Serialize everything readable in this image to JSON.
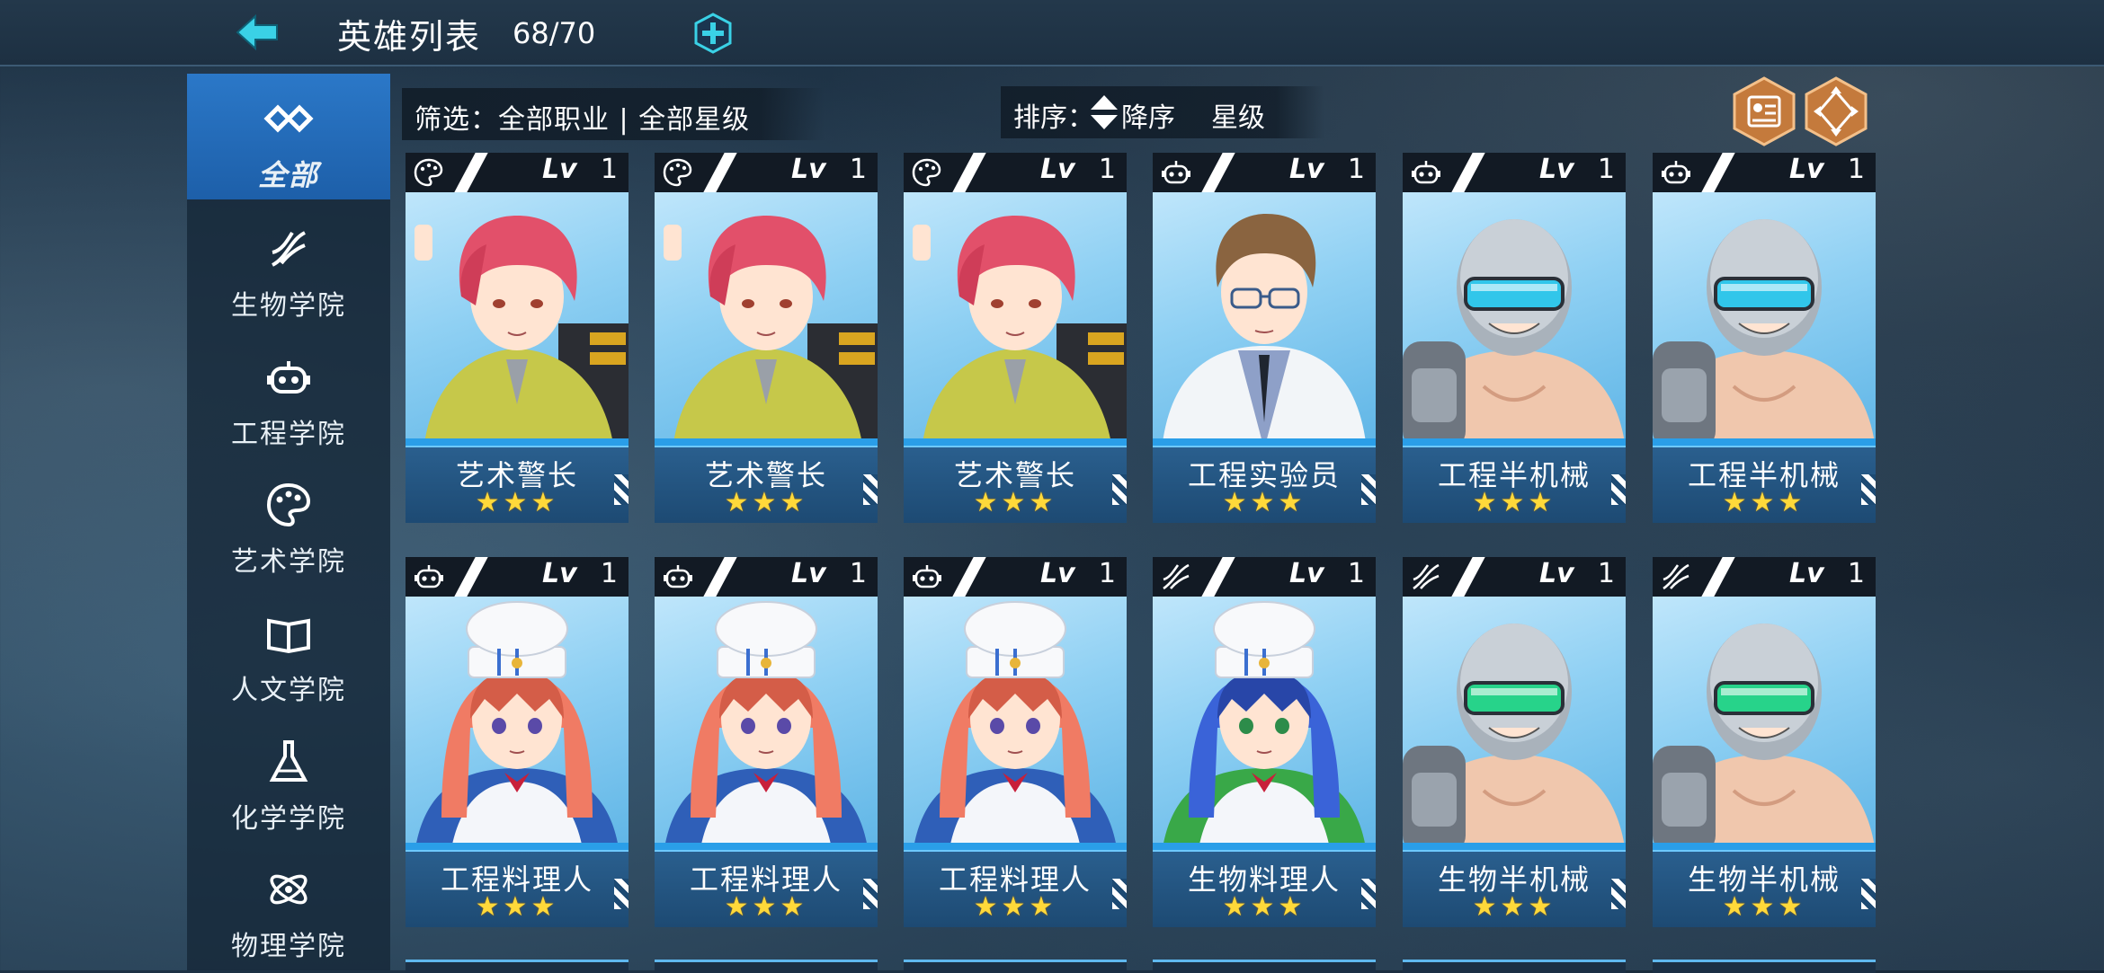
{
  "header": {
    "title": "英雄列表",
    "count": "68/70"
  },
  "sidebar": {
    "items": [
      {
        "label": "全部",
        "icon": "infinity-icon",
        "active": true
      },
      {
        "label": "生物学院",
        "icon": "dna-icon",
        "active": false
      },
      {
        "label": "工程学院",
        "icon": "robot-icon",
        "active": false
      },
      {
        "label": "艺术学院",
        "icon": "palette-icon",
        "active": false
      },
      {
        "label": "人文学院",
        "icon": "book-icon",
        "active": false
      },
      {
        "label": "化学学院",
        "icon": "flask-icon",
        "active": false
      },
      {
        "label": "物理学院",
        "icon": "atom-icon",
        "active": false
      }
    ]
  },
  "filter": {
    "label": "筛选：全部职业 | 全部星级"
  },
  "sort": {
    "label": "排序：",
    "order": "降序",
    "field": "星级"
  },
  "colors": {
    "accent": "#2b78c8",
    "star": "#ffd93a",
    "card_bottom": "#1d4a73"
  },
  "heroes": [
    {
      "name": "艺术警长",
      "class_icon": "palette-icon",
      "lv_label": "Lv",
      "level": "1",
      "stars": "★★★",
      "portrait": "red-hair-boy"
    },
    {
      "name": "艺术警长",
      "class_icon": "palette-icon",
      "lv_label": "Lv",
      "level": "1",
      "stars": "★★★",
      "portrait": "red-hair-boy"
    },
    {
      "name": "艺术警长",
      "class_icon": "palette-icon",
      "lv_label": "Lv",
      "level": "1",
      "stars": "★★★",
      "portrait": "red-hair-boy"
    },
    {
      "name": "工程实验员",
      "class_icon": "robot-icon",
      "lv_label": "Lv",
      "level": "1",
      "stars": "★★★",
      "portrait": "glasses-scientist"
    },
    {
      "name": "工程半机械",
      "class_icon": "robot-icon",
      "lv_label": "Lv",
      "level": "1",
      "stars": "★★★",
      "portrait": "cyborg-blue"
    },
    {
      "name": "工程半机械",
      "class_icon": "robot-icon",
      "lv_label": "Lv",
      "level": "1",
      "stars": "★★★",
      "portrait": "cyborg-blue"
    },
    {
      "name": "工程料理人",
      "class_icon": "robot-icon",
      "lv_label": "Lv",
      "level": "1",
      "stars": "★★★",
      "portrait": "maid-chef-pink"
    },
    {
      "name": "工程料理人",
      "class_icon": "robot-icon",
      "lv_label": "Lv",
      "level": "1",
      "stars": "★★★",
      "portrait": "maid-chef-pink"
    },
    {
      "name": "工程料理人",
      "class_icon": "robot-icon",
      "lv_label": "Lv",
      "level": "1",
      "stars": "★★★",
      "portrait": "maid-chef-pink"
    },
    {
      "name": "生物料理人",
      "class_icon": "dna-icon",
      "lv_label": "Lv",
      "level": "1",
      "stars": "★★★",
      "portrait": "maid-chef-blue"
    },
    {
      "name": "生物半机械",
      "class_icon": "dna-icon",
      "lv_label": "Lv",
      "level": "1",
      "stars": "★★★",
      "portrait": "cyborg-green"
    },
    {
      "name": "生物半机械",
      "class_icon": "dna-icon",
      "lv_label": "Lv",
      "level": "1",
      "stars": "★★★",
      "portrait": "cyborg-green"
    }
  ]
}
